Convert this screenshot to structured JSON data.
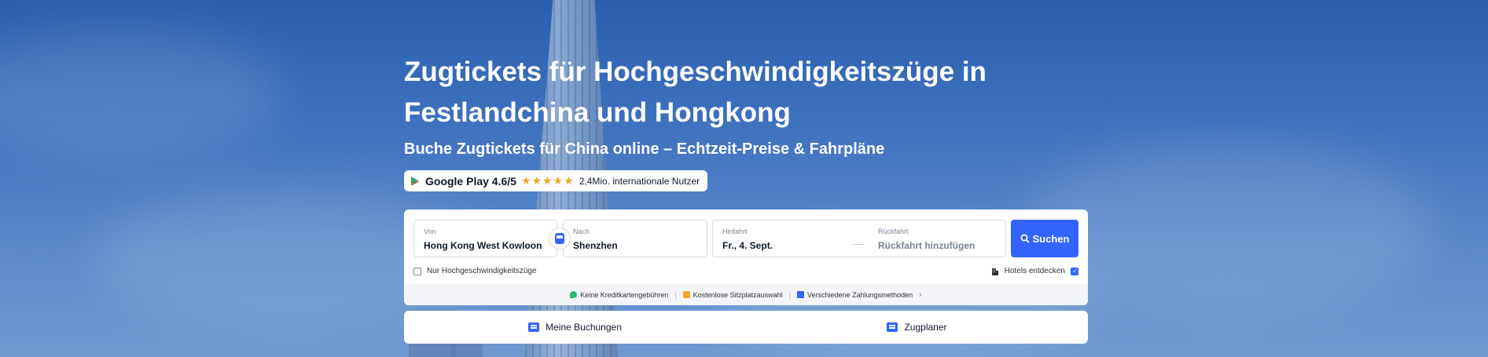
{
  "hero": {
    "title": "Zugtickets für Hochgeschwindigkeitszüge in Festlandchina und Hongkong",
    "subtitle": "Buche Zugtickets für China online – Echtzeit-Preise & Fahrpläne"
  },
  "rating": {
    "store": "Google Play 4.6/5",
    "stars": "★★★★★",
    "users": "2,4Mio. internationale Nutzer"
  },
  "search": {
    "from_label": "Von",
    "from_value": "Hong Kong West Kowloon",
    "to_label": "Nach",
    "to_value": "Shenzhen",
    "depart_label": "Hinfahrt",
    "depart_value": "Fr., 4. Sept.",
    "return_label": "Rückfahrt",
    "return_value": "Rückfahrt hinzufügen",
    "search_button": "Suchen",
    "only_high_speed": "Nur Hochgeschwindigkeitszüge",
    "hotels": "Hotels entdecken"
  },
  "perks": [
    {
      "label": "Keine Kreditkartengebühren",
      "color": "#2bb673"
    },
    {
      "label": "Kostenlose Sitzplatzauswahl",
      "color": "#f5a623"
    },
    {
      "label": "Verschiedene Zahlungsmethoden",
      "color": "#3264ff"
    }
  ],
  "bottom": {
    "bookings": "Meine Buchungen",
    "planner": "Zugplaner"
  },
  "colors": {
    "accent": "#3264ff",
    "star": "#f5a623"
  }
}
